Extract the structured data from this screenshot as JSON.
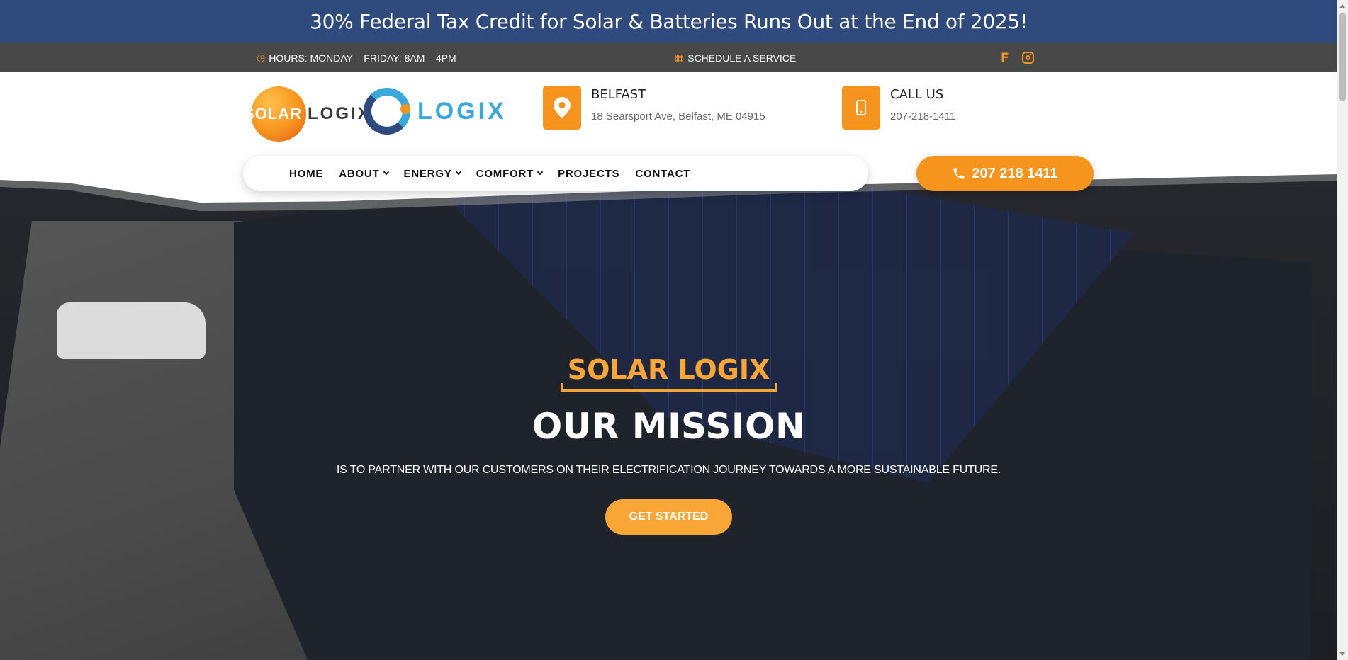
{
  "promo": {
    "text": "30% Federal Tax Credit for Solar & Batteries Runs Out at the End of 2025!"
  },
  "topbar": {
    "hours": "HOURS: MONDAY – FRIDAY: 8AM – 4PM",
    "schedule": "SCHEDULE A SERVICE",
    "social": [
      "facebook-icon",
      "instagram-icon"
    ]
  },
  "logos": {
    "solar_mark": "SOLAR",
    "solar_word": "LOGIX",
    "logix_word": "LOGIX"
  },
  "contact": {
    "location_title": "BELFAST",
    "location_address": "18 Searsport Ave, Belfast, ME 04915",
    "call_title": "CALL US",
    "call_number": "207-218-1411"
  },
  "nav": {
    "items": [
      {
        "label": "HOME",
        "dropdown": false
      },
      {
        "label": "ABOUT",
        "dropdown": true
      },
      {
        "label": "ENERGY",
        "dropdown": true
      },
      {
        "label": "COMFORT",
        "dropdown": true
      },
      {
        "label": "PROJECTS",
        "dropdown": false
      },
      {
        "label": "CONTACT",
        "dropdown": false
      }
    ],
    "call_button": "207 218 1411"
  },
  "hero": {
    "eyebrow": "SOLAR LOGIX",
    "headline": "OUR MISSION",
    "subline": "IS TO PARTNER WITH OUR CUSTOMERS ON THEIR ELECTRIFICATION JOURNEY TOWARDS A MORE SUSTAINABLE FUTURE.",
    "cta": "GET STARTED"
  },
  "colors": {
    "brand_blue": "#2f4a7c",
    "accent_orange": "#f7941d",
    "topbar_gray": "#484848"
  }
}
